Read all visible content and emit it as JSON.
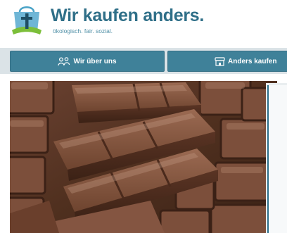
{
  "header": {
    "title": "Wir kaufen anders.",
    "tagline": "ökologisch. fair. sozial.",
    "logo_icon": "shopping-bag-cross-icon"
  },
  "nav": {
    "items": [
      {
        "label": "Wir über uns",
        "icon": "people-icon"
      },
      {
        "label": "Anders kaufen",
        "icon": "shop-icon"
      }
    ]
  },
  "hero": {
    "image": "chocolate-bar-pieces-photo"
  },
  "colors": {
    "brand": "#2f6f88",
    "nav_background": "#3f8199",
    "logo_green": "#7cbf3a"
  }
}
